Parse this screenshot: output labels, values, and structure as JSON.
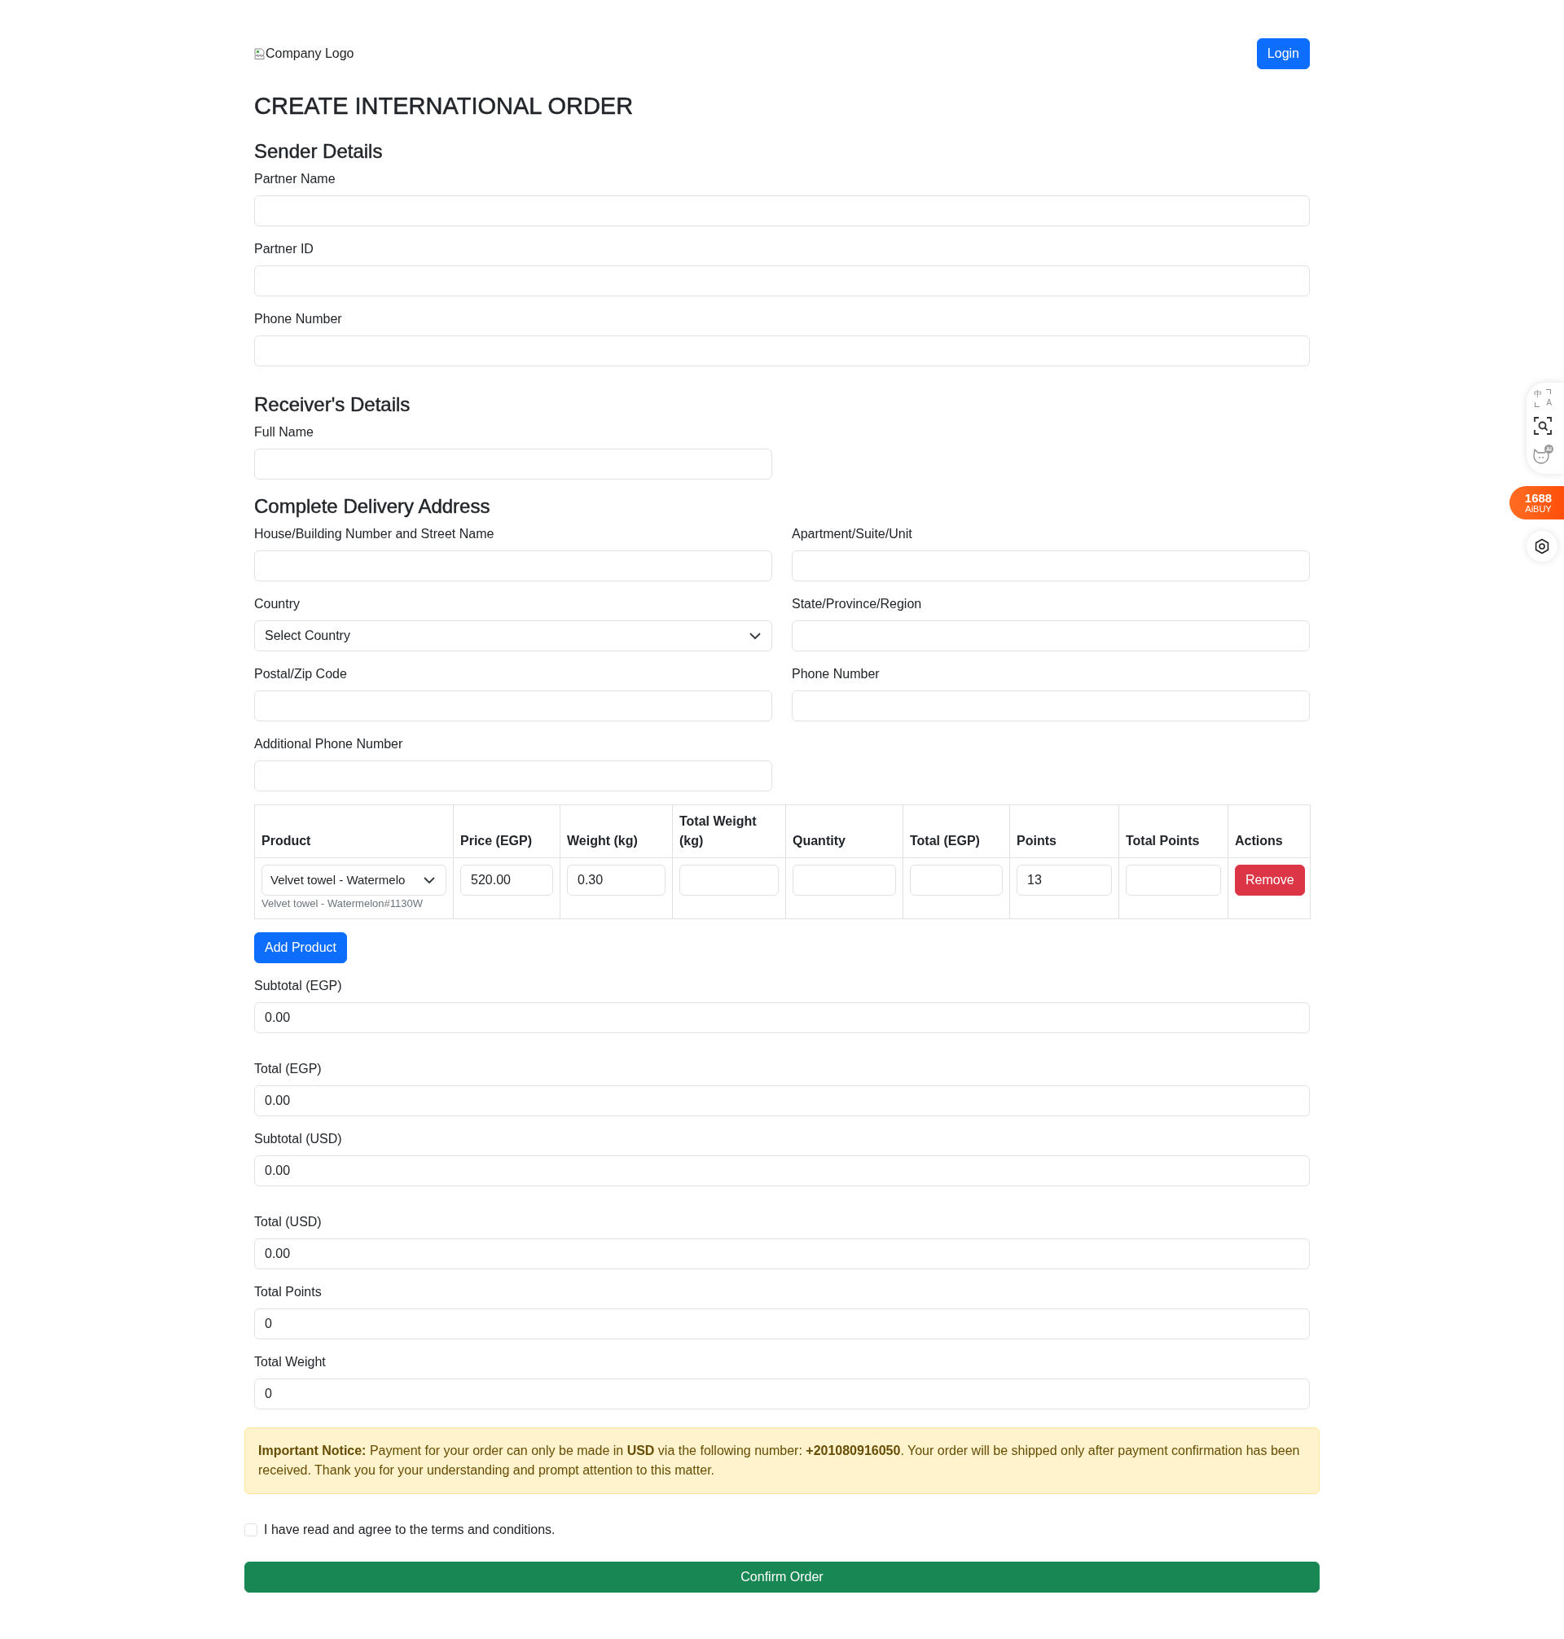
{
  "header": {
    "logo_alt": "Company Logo",
    "login_button": "Login"
  },
  "title": "CREATE INTERNATIONAL ORDER",
  "sender": {
    "heading": "Sender Details",
    "fields": [
      {
        "label": "Partner Name"
      },
      {
        "label": "Partner ID"
      },
      {
        "label": "Phone Number"
      }
    ]
  },
  "receiver": {
    "heading": "Receiver's Details",
    "fields": [
      {
        "label": "Full Name"
      }
    ]
  },
  "address": {
    "heading": "Complete Delivery Address",
    "fields": [
      {
        "label": "House/Building Number and Street Name",
        "kind": "input"
      },
      {
        "label": "Apartment/Suite/Unit",
        "kind": "input"
      },
      {
        "label": "Country",
        "kind": "select",
        "value": "Select Country"
      },
      {
        "label": "State/Province/Region",
        "kind": "input"
      },
      {
        "label": "Postal/Zip Code",
        "kind": "input"
      },
      {
        "label": "Phone Number",
        "kind": "input"
      },
      {
        "label": "Additional Phone Number",
        "kind": "input"
      }
    ]
  },
  "products": {
    "columns": [
      "Product",
      "Price (EGP)",
      "Weight (kg)",
      "Total Weight (kg)",
      "Quantity",
      "Total (EGP)",
      "Points",
      "Total Points",
      "Actions"
    ],
    "rows": [
      {
        "cells": [
          {
            "kind": "select",
            "value": "Velvet towel - Watermelo",
            "note": "Velvet towel - Watermelon#1130W"
          },
          {
            "kind": "input",
            "value": "520.00"
          },
          {
            "kind": "input",
            "value": "0.30"
          },
          {
            "kind": "input"
          },
          {
            "kind": "input"
          },
          {
            "kind": "input"
          },
          {
            "kind": "input",
            "value": "13"
          },
          {
            "kind": "input"
          },
          {
            "kind": "button",
            "label": "Remove"
          }
        ]
      }
    ]
  },
  "add_product_button": "Add Product",
  "summary": [
    {
      "label": "Subtotal (EGP)",
      "value": "0.00"
    },
    {
      "label": "Total (EGP)",
      "value": "0.00"
    },
    {
      "label": "Subtotal (USD)",
      "value": "0.00"
    },
    {
      "label": "Total (USD)",
      "value": "0.00"
    },
    {
      "label": "Total Points",
      "value": "0"
    },
    {
      "label": "Total Weight",
      "value": "0"
    }
  ],
  "notice": "**Important Notice:** Payment for your order can only be made in **USD** via the following number: **+201080916050**. Your order will be shipped only after payment confirmation has been received. Thank you for your understanding and prompt attention to this matter.",
  "terms": {
    "label": "I have read and agree to the terms and conditions.",
    "checked": false
  },
  "confirm_button": "Confirm Order",
  "extension": {
    "translate": [
      "中",
      "A"
    ],
    "ai_badge": "AI",
    "brand": [
      "1688",
      "AiBUY"
    ]
  }
}
